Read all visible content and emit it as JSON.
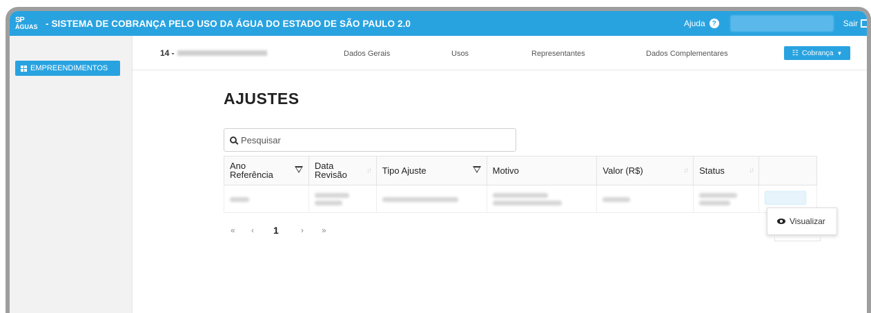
{
  "topbar": {
    "logo_line1": "SP",
    "logo_line2": "ÁGUAS",
    "title": "- SISTEMA DE COBRANÇA PELO USO DA ÁGUA DO ESTADO DE SÃO PAULO 2.0",
    "help_label": "Ajuda",
    "help_icon": "?",
    "logout_label": "Sair"
  },
  "sidebar": {
    "items": [
      {
        "label": "EMPREENDIMENTOS",
        "icon": "grid-icon"
      }
    ]
  },
  "subnav": {
    "project_prefix": "14 -",
    "tabs": [
      "Dados Gerais",
      "Usos",
      "Representantes",
      "Dados Complementares"
    ],
    "cobranca_label": "Cobrança",
    "cobranca_icon": "list-check-icon"
  },
  "page": {
    "title": "AJUSTES",
    "search_placeholder": "Pesquisar"
  },
  "table": {
    "columns": [
      {
        "label": "Ano Referência",
        "icon": "filter-icon"
      },
      {
        "label": "Data Revisão",
        "icon": "sort-icon"
      },
      {
        "label": "Tipo Ajuste",
        "icon": "filter-icon"
      },
      {
        "label": "Motivo",
        "icon": ""
      },
      {
        "label": "Valor (R$)",
        "icon": "sort-icon"
      },
      {
        "label": "Status",
        "icon": "sort-icon"
      },
      {
        "label": "",
        "icon": ""
      }
    ]
  },
  "dropdown": {
    "items": [
      {
        "label": "Visualizar",
        "icon": "eye-icon"
      }
    ]
  },
  "pagination": {
    "first": "«",
    "prev": "‹",
    "current": "1",
    "next": "›",
    "last": "»"
  },
  "colors": {
    "accent": "#29a3e0",
    "sidebar_bg": "#f2f2f2"
  }
}
